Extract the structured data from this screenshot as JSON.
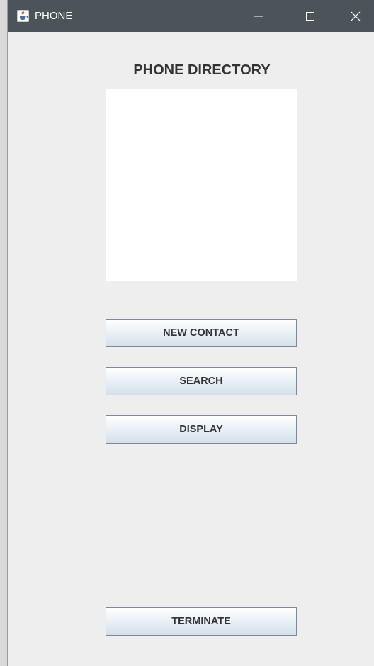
{
  "window": {
    "title": "PHONE",
    "icon": "java-cup-icon",
    "controls": [
      "minimize-icon",
      "maximize-icon",
      "close-icon"
    ]
  },
  "main": {
    "heading": "PHONE DIRECTORY",
    "display_area_text": ""
  },
  "buttons": {
    "new_contact": "NEW CONTACT",
    "search": "SEARCH",
    "display": "DISPLAY",
    "terminate": "TERMINATE"
  }
}
